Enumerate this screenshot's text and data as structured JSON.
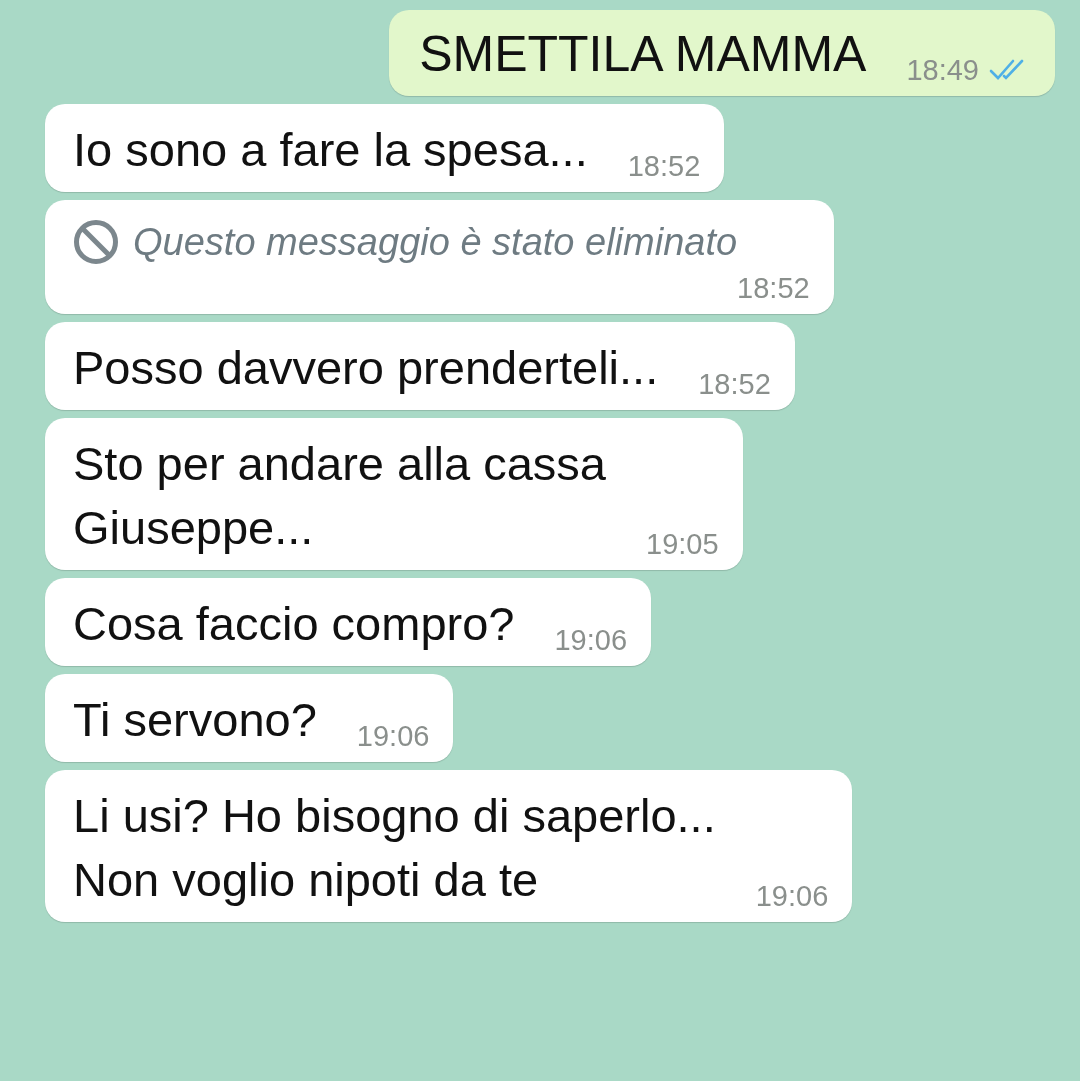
{
  "messages": [
    {
      "kind": "outgoing",
      "text": "SMETTILA MAMMA",
      "time": "18:49",
      "read": true
    },
    {
      "kind": "incoming",
      "text": "Io sono a fare la spesa...",
      "time": "18:52"
    },
    {
      "kind": "deleted",
      "text": "Questo messaggio è stato eliminato",
      "time": "18:52"
    },
    {
      "kind": "incoming",
      "text": "Posso davvero prenderteli...",
      "time": "18:52"
    },
    {
      "kind": "incoming",
      "text": "Sto per andare alla cassa\nGiuseppe...",
      "time": "19:05"
    },
    {
      "kind": "incoming",
      "text": "Cosa faccio compro?",
      "time": "19:06"
    },
    {
      "kind": "incoming",
      "text": "Ti servono?",
      "time": "19:06"
    },
    {
      "kind": "incoming",
      "text": "Li usi? Ho bisogno di saperlo...\nNon voglio nipoti da te",
      "time": "19:06"
    }
  ]
}
